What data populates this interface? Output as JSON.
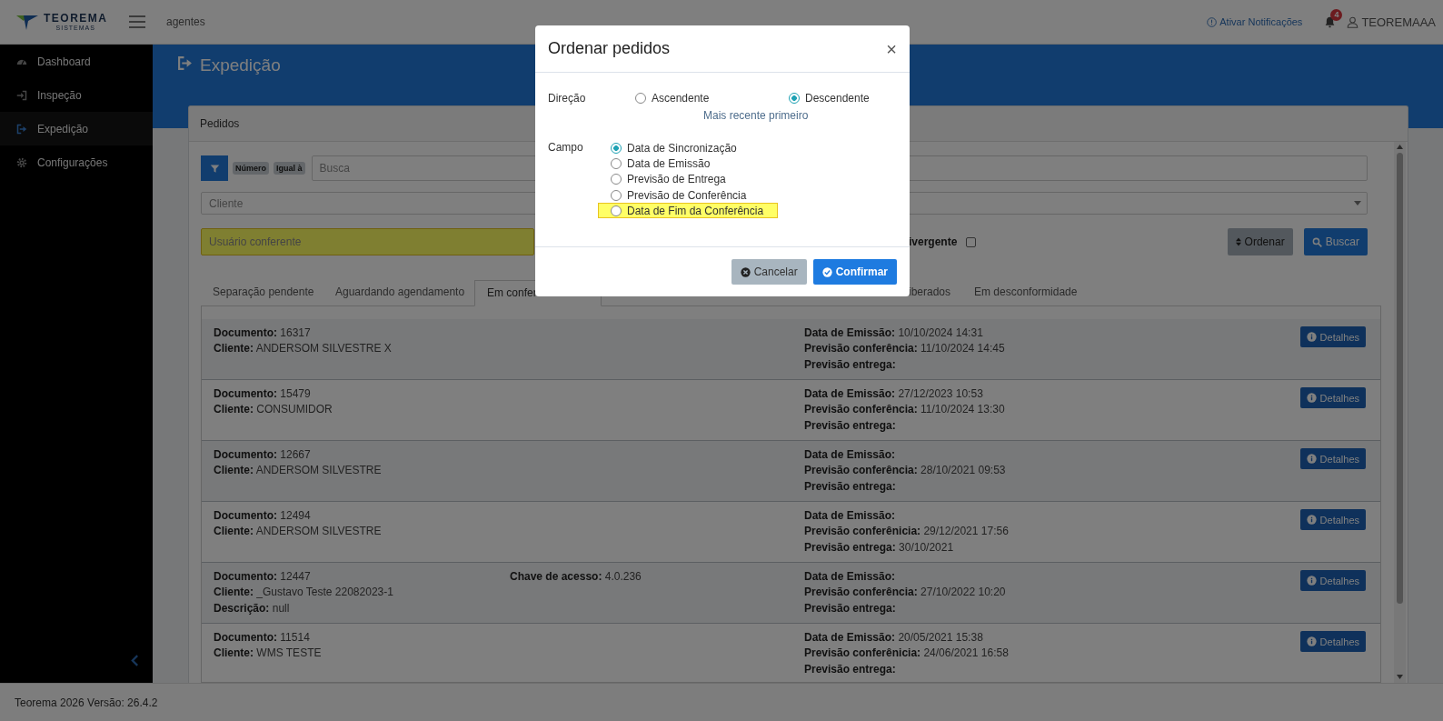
{
  "header": {
    "logo": {
      "name": "TEOREMA",
      "tagline": "SISTEMAS"
    },
    "breadcrumb": "agentes",
    "notifications_link": "Ativar Notificações",
    "notification_count": "4",
    "user": "TEOREMAAA"
  },
  "sidebar": {
    "items": [
      {
        "label": "Dashboard",
        "selected": false
      },
      {
        "label": "Inspeção",
        "selected": false
      },
      {
        "label": "Expedição",
        "selected": true
      },
      {
        "label": "Configurações",
        "selected": false
      }
    ]
  },
  "page_title": "Expedição",
  "card": {
    "title": "Pedidos",
    "filters": {
      "badges": [
        "Número",
        "Igual à"
      ],
      "search_placeholder": "Busca",
      "client_placeholder": "Cliente",
      "user_field": {
        "placeholder": "Usuário conferente",
        "highlighted": true
      },
      "divergent": {
        "label": "ivergente",
        "checked": false
      },
      "sort_button": "Ordenar",
      "search_button": "Buscar"
    },
    "tabs": [
      {
        "label": "Separação pendente",
        "selected": false
      },
      {
        "label": "Aguardando agendamento",
        "selected": false
      },
      {
        "label": "Em confer",
        "selected": true
      },
      {
        "label": "iberados",
        "selected": false
      },
      {
        "label": "Em desconformidade",
        "selected": false
      }
    ],
    "orders": [
      {
        "left": [
          {
            "label": "Documento:",
            "value": "16317"
          },
          {
            "label": "Cliente:",
            "value": "ANDERSOM SILVESTRE X"
          }
        ],
        "right": [
          {
            "label": "Data de Emissão:",
            "value": "10/10/2024 14:31"
          },
          {
            "label": "Previsão conferência:",
            "value": "11/10/2024 14:45"
          },
          {
            "label": "Previsão entrega:"
          }
        ],
        "button": "Detalhes"
      },
      {
        "left": [
          {
            "label": "Documento:",
            "value": "15479"
          },
          {
            "label": "Cliente:",
            "value": "CONSUMIDOR"
          }
        ],
        "right": [
          {
            "label": "Data de Emissão:",
            "value": "27/12/2023 10:53"
          },
          {
            "label": "Previsão conferência:",
            "value": "11/10/2024 13:30"
          },
          {
            "label": "Previsão entrega:"
          }
        ],
        "button": "Detalhes"
      },
      {
        "left": [
          {
            "label": "Documento:",
            "value": "12667"
          },
          {
            "label": "Cliente:",
            "value": "ANDERSOM SILVESTRE"
          }
        ],
        "right": [
          {
            "label": "Data de Emissão:"
          },
          {
            "label": "Previsão conferência:",
            "value": "28/10/2021 09:53"
          },
          {
            "label": "Previsão entrega:"
          }
        ],
        "button": "Detalhes"
      },
      {
        "left": [
          {
            "label": "Documento:",
            "value": "12494"
          },
          {
            "label": "Cliente:",
            "value": "ANDERSOM SILVESTRE"
          }
        ],
        "right": [
          {
            "label": "Data de Emissão:"
          },
          {
            "label": "Previsão conferênicia:",
            "value": "29/12/2021 17:56"
          },
          {
            "label": "Previsão entrega:",
            "value": "30/10/2021"
          }
        ],
        "button": "Detalhes"
      },
      {
        "left": [
          {
            "label": "Documento:",
            "value": "12447"
          },
          {
            "label": "Cliente:",
            "value": "_Gustavo Teste 22082023-1"
          },
          {
            "label": "Descrição:",
            "value": "null"
          }
        ],
        "middle": [
          {
            "label": "Chave de acesso:",
            "value": "4.0.236"
          }
        ],
        "right": [
          {
            "label": "Data de Emissão:"
          },
          {
            "label": "Previsão conferência:",
            "value": "27/10/2022 10:20"
          },
          {
            "label": "Previsão entrega:"
          }
        ],
        "button": "Detalhes"
      },
      {
        "left": [
          {
            "label": "Documento:",
            "value": "11514"
          },
          {
            "label": "Cliente:",
            "value": "WMS TESTE"
          }
        ],
        "right": [
          {
            "label": "Data de Emissão:",
            "value": "20/05/2021 15:38"
          },
          {
            "label": "Previsão conferênicia:",
            "value": "24/06/2021 16:58"
          },
          {
            "label": "Previsão entrega:"
          }
        ],
        "button": "Detalhes"
      }
    ]
  },
  "modal": {
    "title": "Ordenar pedidos",
    "close": "×",
    "direction": {
      "label": "Direção",
      "options": [
        {
          "label": "Ascendente",
          "selected": false
        },
        {
          "label": "Descendente",
          "selected": true
        }
      ],
      "hint": "Mais recente primeiro"
    },
    "field": {
      "label": "Campo",
      "options": [
        {
          "label": "Data de Sincronização",
          "selected": true,
          "highlighted": false
        },
        {
          "label": "Data de Emissão",
          "selected": false,
          "highlighted": false
        },
        {
          "label": "Previsão de Entrega",
          "selected": false,
          "highlighted": false
        },
        {
          "label": "Previsão de Conferência",
          "selected": false,
          "highlighted": false
        },
        {
          "label": "Data de Fim da Conferência",
          "selected": false,
          "highlighted": true
        }
      ]
    },
    "buttons": [
      {
        "label": "Cancelar",
        "kind": "secondary"
      },
      {
        "label": "Confirmar",
        "kind": "primary"
      }
    ]
  },
  "footer": "Teorema 2026 Versão: 26.4.2"
}
